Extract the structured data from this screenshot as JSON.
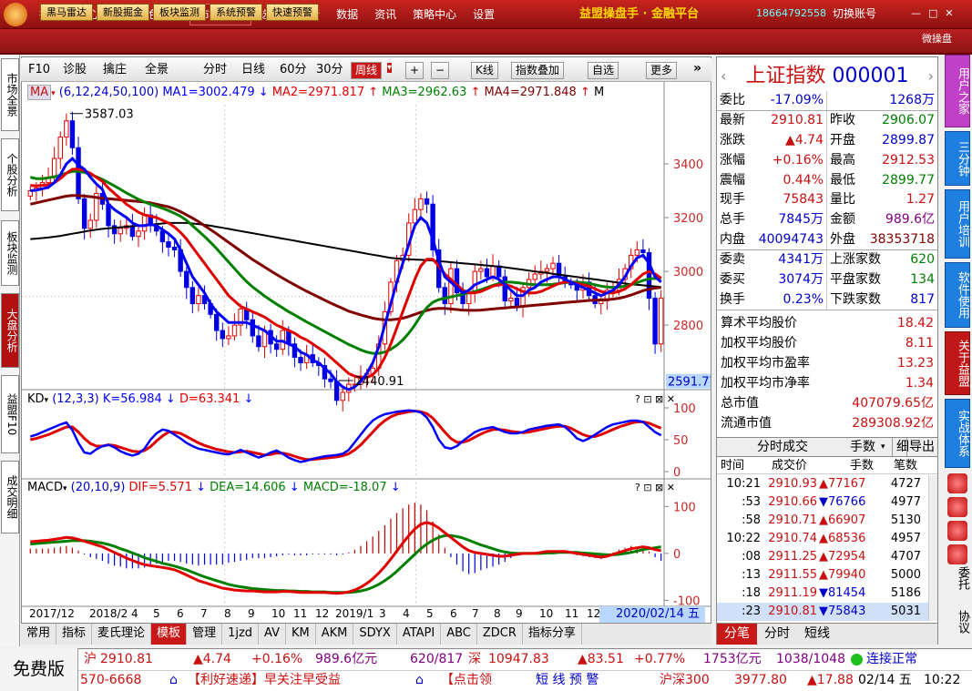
{
  "menu": {
    "items": [
      "投顾",
      "核心功能",
      "特色功能",
      "市场监测",
      "选股",
      "行情",
      "数据",
      "资讯",
      "策略中心",
      "设置"
    ],
    "active_index": 3,
    "brand": "益盟操盘手 · 金融平台",
    "phone": "18664792558",
    "switch_account": "切换账号"
  },
  "toolbar": {
    "buttons": [
      "黑马雷达",
      "新股掘金",
      "板块监测",
      "系统预警",
      "快速预警"
    ],
    "right_label": "微操盘"
  },
  "left_tabs": [
    "市场全景",
    "个股分析",
    "板块监测",
    "大盘分析",
    "益盟F10",
    "成交明细"
  ],
  "left_tab_active": 3,
  "chart_toolbar": {
    "items": [
      "F10",
      "诊股",
      "擒庄",
      "全景"
    ],
    "period_buttons": [
      "分时",
      "日线",
      "60分",
      "30分",
      "周线"
    ],
    "active_period": "周线",
    "other": [
      "K线",
      "指数叠加",
      "自选",
      "更多"
    ]
  },
  "ma_legend": {
    "name": "MA",
    "params": "(6,12,24,50,100)",
    "ma1": "MA1=3002.479",
    "ma2": "MA2=2971.817",
    "ma3": "MA3=2962.63",
    "ma4": "MA4=2971.848",
    "more": "M"
  },
  "kd_legend": {
    "name": "KD",
    "params": "(12,3,3)",
    "k": "K=56.984",
    "d": "D=63.341"
  },
  "macd_legend": {
    "name": "MACD",
    "params": "(20,10,9)",
    "dif": "DIF=5.571",
    "dea": "DEA=14.606",
    "macd": "MACD=-18.07"
  },
  "price_axis": [
    "3400",
    "3200",
    "3000",
    "2800"
  ],
  "current_price_tag": "2591.77",
  "kd_axis": [
    "100",
    "50",
    "0"
  ],
  "macd_axis": [
    "100",
    "0",
    "-100"
  ],
  "annotations": {
    "high": "3587.03",
    "low": "2440.91"
  },
  "x_labels": [
    "2017/12",
    "2018/2",
    "4",
    "5",
    "6",
    "7",
    "8",
    "9",
    "10",
    "11",
    "12",
    "2019/1",
    "3",
    "4",
    "5",
    "6",
    "7",
    "8",
    "9",
    "10",
    "11",
    "12"
  ],
  "current_date": "2020/02/14 五",
  "bottom_tabs": [
    "常用",
    "指标",
    "麦氏理论",
    "模板",
    "管理",
    "1jzd",
    "AV",
    "KM",
    "AKM",
    "SDYX",
    "ATAPI",
    "ABC",
    "ZDCR",
    "指标分享"
  ],
  "bottom_tab_active": 3,
  "quote": {
    "title": "上证指数",
    "code": "000001",
    "rows": [
      [
        "委比",
        "-17.09%",
        "",
        "1268万"
      ],
      [
        "最新",
        "2910.81",
        "昨收",
        "2906.07"
      ],
      [
        "涨跌",
        "▲4.74",
        "开盘",
        "2899.87"
      ],
      [
        "涨幅",
        "+0.16%",
        "最高",
        "2912.53"
      ],
      [
        "震幅",
        "0.44%",
        "最低",
        "2899.77"
      ],
      [
        "现手",
        "75843",
        "量比",
        "1.27"
      ],
      [
        "总手",
        "7845万",
        "金额",
        "989.6亿"
      ],
      [
        "内盘",
        "40094743",
        "外盘",
        "38353718"
      ],
      [
        "委卖",
        "4341万",
        "上涨家数",
        "620"
      ],
      [
        "委买",
        "3074万",
        "平盘家数",
        "134"
      ],
      [
        "换手",
        "0.23%",
        "下跌家数",
        "817"
      ]
    ],
    "wide_rows": [
      [
        "算术平均股价",
        "18.42"
      ],
      [
        "加权平均股价",
        "8.11"
      ],
      [
        "加权平均市盈率",
        "13.23"
      ],
      [
        "加权平均市净率",
        "1.34"
      ],
      [
        "总市值",
        "407079.65亿"
      ],
      [
        "流通市值",
        "289308.92亿"
      ]
    ]
  },
  "trades": {
    "header": "分时成交",
    "controls": [
      "手数",
      "细",
      "导出"
    ],
    "columns": [
      "时间",
      "成交价",
      "手数",
      "笔数"
    ],
    "rows": [
      [
        "10:21",
        "2910.93",
        "▲77167",
        "4727"
      ],
      [
        ":53",
        "2910.66",
        "▼76766",
        "4977"
      ],
      [
        ":58",
        "2910.71",
        "▲66907",
        "5130"
      ],
      [
        "10:22",
        "2910.74",
        "▲68536",
        "4957"
      ],
      [
        ":08",
        "2911.25",
        "▲72954",
        "4707"
      ],
      [
        ":13",
        "2911.55",
        "▲79940",
        "5000"
      ],
      [
        ":18",
        "2911.19",
        "▼81454",
        "5186"
      ],
      [
        ":23",
        "2910.81",
        "▼75843",
        "5031"
      ]
    ],
    "selected_row": 7
  },
  "right_bottom_tabs": [
    "分笔",
    "分时",
    "短线"
  ],
  "far_right_tabs": [
    "用户之家",
    "三分钟",
    "用户培训",
    "软件使用",
    "关于益盟",
    "实战体系"
  ],
  "far_right_text": [
    "委托",
    "协议"
  ],
  "ticker1": {
    "sh_label": "沪",
    "sh_price": "2910.81",
    "sh_change": "▲4.74",
    "sh_pct": "+0.16%",
    "sh_amount": "989.6亿元",
    "sh_updown": "620/817",
    "sz_label": "深",
    "sz_price": "10947.83",
    "sz_change": "▲83.51",
    "sz_pct": "+0.77%",
    "sz_amount": "1753亿元",
    "sz_updown": "1038/1048",
    "status": "连接正常"
  },
  "ticker2": {
    "phone": "570-6668",
    "msg1": "【利好速递】早关注早受益",
    "msg2": "【点击领",
    "alert": "短 线 预 警",
    "hs300": "沪深300",
    "hs300_price": "3977.80",
    "hs300_change": "▲17.88",
    "date": "02/14 五",
    "time": "10:22"
  },
  "free_label": "免费版",
  "chart_data": {
    "type": "candlestick",
    "period": "weekly",
    "price_range": [
      2440.91,
      3587.03
    ],
    "ylim": [
      2560,
      3620
    ],
    "close": [
      3300,
      3310,
      3330,
      3350,
      3420,
      3500,
      3560,
      3460,
      3270,
      3160,
      3190,
      3290,
      3250,
      3170,
      3140,
      3160,
      3170,
      3130,
      3150,
      3210,
      3170,
      3150,
      3110,
      3090,
      3080,
      3000,
      2940,
      2880,
      2910,
      2880,
      2840,
      2780,
      2750,
      2760,
      2800,
      2860,
      2820,
      2760,
      2720,
      2780,
      2730,
      2710,
      2780,
      2730,
      2680,
      2660,
      2690,
      2660,
      2650,
      2600,
      2590,
      2520,
      2550,
      2580,
      2580,
      2610,
      2620,
      2640,
      2730,
      2850,
      2960,
      3040,
      3060,
      3180,
      3230,
      3270,
      3250,
      3080,
      2940,
      2880,
      3010,
      2920,
      2880,
      2920,
      3000,
      3010,
      2980,
      3020,
      2980,
      2890,
      2900,
      2870,
      2940,
      2970,
      2990,
      3000,
      3010,
      3030,
      2980,
      2960,
      2950,
      2930,
      2960,
      2910,
      2880,
      2890,
      2930,
      2930,
      2970,
      3010,
      3060,
      3080,
      3070,
      2900,
      2730,
      2900
    ],
    "ma1": [
      3300,
      3302,
      3307,
      3313,
      3330,
      3360,
      3400,
      3420,
      3395,
      3380,
      3350,
      3325,
      3305,
      3250,
      3230,
      3215,
      3200,
      3180,
      3170,
      3170,
      3175,
      3170,
      3155,
      3140,
      3120,
      3080,
      3030,
      2980,
      2950,
      2920,
      2880,
      2850,
      2830,
      2810,
      2810,
      2810,
      2810,
      2800,
      2790,
      2780,
      2760,
      2740,
      2740,
      2730,
      2720,
      2700,
      2690,
      2670,
      2660,
      2640,
      2620,
      2590,
      2570,
      2560,
      2570,
      2590,
      2620,
      2660,
      2720,
      2800,
      2880,
      2960,
      3030,
      3100,
      3170,
      3200,
      3180,
      3120,
      3040,
      2980,
      2960,
      2940,
      2920,
      2930,
      2950,
      2960,
      2970,
      2980,
      2970,
      2950,
      2930,
      2910,
      2910,
      2930,
      2940,
      2960,
      2970,
      2980,
      2980,
      2970,
      2960,
      2950,
      2940,
      2930,
      2920,
      2910,
      2920,
      2930,
      2950,
      2980,
      3020,
      3050,
      3060,
      3030,
      2980,
      2960
    ],
    "ma2": [
      3320,
      3318,
      3320,
      3322,
      3330,
      3345,
      3365,
      3380,
      3380,
      3375,
      3365,
      3350,
      3335,
      3310,
      3290,
      3270,
      3250,
      3235,
      3220,
      3210,
      3205,
      3200,
      3190,
      3180,
      3165,
      3145,
      3120,
      3090,
      3060,
      3030,
      3000,
      2970,
      2940,
      2910,
      2890,
      2870,
      2860,
      2850,
      2840,
      2830,
      2815,
      2800,
      2790,
      2780,
      2770,
      2755,
      2745,
      2730,
      2715,
      2700,
      2680,
      2660,
      2640,
      2620,
      2610,
      2605,
      2605,
      2615,
      2640,
      2680,
      2730,
      2790,
      2850,
      2910,
      2970,
      3020,
      3045,
      3045,
      3020,
      2990,
      2970,
      2950,
      2930,
      2920,
      2920,
      2925,
      2935,
      2945,
      2950,
      2950,
      2945,
      2935,
      2925,
      2920,
      2920,
      2925,
      2935,
      2945,
      2955,
      2960,
      2960,
      2955,
      2950,
      2945,
      2935,
      2925,
      2920,
      2920,
      2925,
      2935,
      2950,
      2970,
      2990,
      3000,
      2990,
      2975
    ],
    "ma3": [
      3350,
      3345,
      3345,
      3348,
      3352,
      3358,
      3366,
      3372,
      3372,
      3368,
      3360,
      3352,
      3342,
      3330,
      3318,
      3305,
      3292,
      3280,
      3268,
      3258,
      3250,
      3242,
      3235,
      3226,
      3216,
      3205,
      3190,
      3170,
      3150,
      3130,
      3108,
      3085,
      3060,
      3035,
      3010,
      2985,
      2962,
      2942,
      2925,
      2908,
      2893,
      2878,
      2864,
      2850,
      2838,
      2825,
      2812,
      2800,
      2788,
      2776,
      2764,
      2752,
      2740,
      2728,
      2718,
      2708,
      2700,
      2695,
      2695,
      2700,
      2710,
      2725,
      2745,
      2770,
      2800,
      2835,
      2865,
      2885,
      2895,
      2900,
      2905,
      2910,
      2915,
      2920,
      2925,
      2932,
      2940,
      2948,
      2955,
      2960,
      2960,
      2958,
      2955,
      2952,
      2950,
      2950,
      2950,
      2952,
      2955,
      2958,
      2960,
      2960,
      2958,
      2955,
      2950,
      2945,
      2942,
      2940,
      2942,
      2945,
      2950,
      2958,
      2966,
      2972,
      2974,
      2972
    ],
    "ma4": [
      3250,
      3255,
      3260,
      3265,
      3270,
      3275,
      3280,
      3282,
      3282,
      3280,
      3278,
      3275,
      3272,
      3270,
      3268,
      3266,
      3264,
      3262,
      3260,
      3258,
      3255,
      3250,
      3245,
      3240,
      3232,
      3222,
      3210,
      3198,
      3185,
      3170,
      3155,
      3140,
      3124,
      3108,
      3092,
      3076,
      3060,
      3044,
      3030,
      3016,
      3002,
      2988,
      2975,
      2962,
      2950,
      2938,
      2926,
      2915,
      2904,
      2893,
      2882,
      2872,
      2862,
      2852,
      2845,
      2838,
      2832,
      2826,
      2822,
      2820,
      2820,
      2822,
      2826,
      2832,
      2840,
      2848,
      2855,
      2860,
      2862,
      2862,
      2860,
      2858,
      2856,
      2855,
      2855,
      2856,
      2858,
      2860,
      2862,
      2864,
      2866,
      2868,
      2870,
      2872,
      2874,
      2876,
      2878,
      2880,
      2882,
      2884,
      2886,
      2888,
      2890,
      2892,
      2893,
      2894,
      2895,
      2897,
      2900,
      2905,
      2912,
      2920,
      2928,
      2934,
      2938,
      2940
    ],
    "ma5": [
      3120,
      3122,
      3124,
      3126,
      3129,
      3132,
      3136,
      3140,
      3144,
      3148,
      3152,
      3155,
      3158,
      3160,
      3162,
      3164,
      3166,
      3168,
      3170,
      3172,
      3174,
      3176,
      3178,
      3180,
      3180,
      3180,
      3180,
      3178,
      3176,
      3173,
      3170,
      3166,
      3162,
      3158,
      3154,
      3150,
      3146,
      3142,
      3138,
      3134,
      3130,
      3126,
      3122,
      3118,
      3114,
      3110,
      3106,
      3102,
      3098,
      3094,
      3090,
      3086,
      3082,
      3078,
      3074,
      3070,
      3066,
      3062,
      3058,
      3054,
      3050,
      3048,
      3046,
      3045,
      3044,
      3043,
      3042,
      3040,
      3038,
      3036,
      3034,
      3032,
      3030,
      3028,
      3026,
      3024,
      3022,
      3020,
      3018,
      3015,
      3012,
      3009,
      3006,
      3003,
      3000,
      2997,
      2994,
      2991,
      2988,
      2985,
      2982,
      2979,
      2976,
      2973,
      2970,
      2967,
      2964,
      2961,
      2958,
      2955,
      2952,
      2950,
      2948,
      2946,
      2944,
      2942
    ],
    "kd_k": [
      55,
      58,
      62,
      66,
      70,
      74,
      77,
      65,
      45,
      30,
      28,
      35,
      40,
      42,
      38,
      32,
      28,
      25,
      28,
      36,
      50,
      60,
      66,
      64,
      58,
      52,
      45,
      40,
      36,
      34,
      32,
      30,
      28,
      27,
      30,
      34,
      30,
      26,
      22,
      25,
      30,
      33,
      28,
      22,
      18,
      15,
      17,
      20,
      22,
      24,
      25,
      26,
      28,
      34,
      46,
      58,
      70,
      80,
      86,
      90,
      92,
      94,
      95,
      96,
      95,
      93,
      85,
      70,
      50,
      38,
      36,
      40,
      48,
      55,
      62,
      66,
      68,
      70,
      66,
      62,
      60,
      60,
      62,
      66,
      68,
      70,
      72,
      73,
      74,
      70,
      62,
      52,
      48,
      52,
      58,
      64,
      70,
      74,
      76,
      78,
      80,
      80,
      78,
      70,
      62,
      57
    ],
    "kd_d": [
      50,
      52,
      55,
      58,
      62,
      66,
      70,
      70,
      62,
      52,
      44,
      40,
      40,
      42,
      41,
      38,
      35,
      32,
      31,
      33,
      39,
      48,
      56,
      62,
      62,
      60,
      55,
      50,
      45,
      41,
      38,
      35,
      33,
      31,
      30,
      31,
      32,
      30,
      28,
      26,
      27,
      29,
      29,
      27,
      24,
      21,
      19,
      19,
      20,
      21,
      22,
      23,
      25,
      28,
      34,
      42,
      52,
      62,
      72,
      80,
      86,
      90,
      92,
      94,
      95,
      94,
      91,
      84,
      73,
      62,
      52,
      46,
      46,
      49,
      54,
      59,
      63,
      66,
      66,
      65,
      63,
      62,
      61,
      62,
      64,
      66,
      68,
      70,
      71,
      71,
      68,
      63,
      58,
      55,
      55,
      58,
      62,
      66,
      70,
      73,
      76,
      78,
      78,
      76,
      72,
      68
    ],
    "macd_dif": [
      25,
      26,
      27,
      28,
      30,
      32,
      34,
      33,
      30,
      26,
      22,
      18,
      14,
      8,
      2,
      -4,
      -10,
      -15,
      -20,
      -24,
      -26,
      -28,
      -30,
      -32,
      -35,
      -40,
      -46,
      -52,
      -58,
      -62,
      -66,
      -70,
      -74,
      -76,
      -78,
      -79,
      -80,
      -80,
      -81,
      -82,
      -82,
      -82,
      -81,
      -81,
      -82,
      -83,
      -83,
      -83,
      -83,
      -83,
      -84,
      -85,
      -84,
      -82,
      -78,
      -72,
      -64,
      -54,
      -42,
      -28,
      -12,
      5,
      22,
      38,
      52,
      62,
      66,
      62,
      54,
      44,
      34,
      24,
      14,
      6,
      2,
      0,
      -2,
      -4,
      -6,
      -6,
      -4,
      -2,
      0,
      0,
      0,
      2,
      4,
      4,
      4,
      4,
      2,
      0,
      -2,
      -4,
      -6,
      -8,
      -6,
      -2,
      2,
      6,
      10,
      12,
      14,
      12,
      8,
      6
    ],
    "macd_dea": [
      20,
      21,
      22,
      23,
      24,
      25,
      26,
      27,
      27,
      27,
      26,
      24,
      22,
      19,
      15,
      10,
      6,
      1,
      -4,
      -9,
      -13,
      -17,
      -21,
      -24,
      -27,
      -31,
      -35,
      -40,
      -45,
      -50,
      -54,
      -58,
      -62,
      -66,
      -69,
      -71,
      -73,
      -75,
      -76,
      -77,
      -78,
      -79,
      -79,
      -80,
      -80,
      -81,
      -81,
      -82,
      -82,
      -82,
      -83,
      -83,
      -83,
      -83,
      -82,
      -80,
      -77,
      -72,
      -66,
      -58,
      -49,
      -38,
      -26,
      -14,
      -2,
      10,
      20,
      28,
      34,
      38,
      38,
      36,
      33,
      28,
      23,
      18,
      14,
      10,
      6,
      3,
      1,
      0,
      0,
      0,
      0,
      0,
      1,
      1,
      2,
      2,
      2,
      2,
      1,
      0,
      -1,
      -2,
      -3,
      -3,
      -2,
      0,
      2,
      5,
      8,
      10,
      12,
      14
    ]
  }
}
